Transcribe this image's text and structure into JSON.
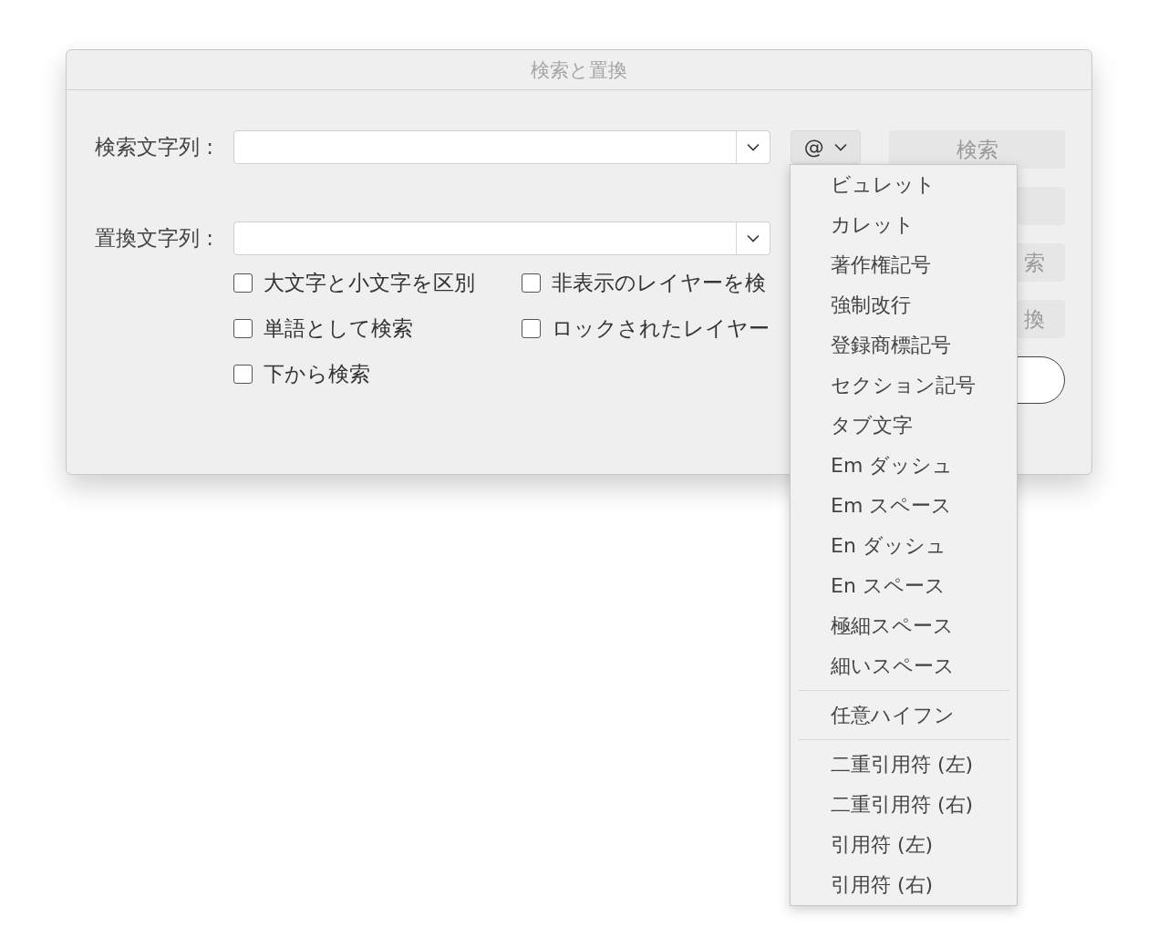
{
  "window": {
    "title": "検索と置換"
  },
  "fields": [
    {
      "label": "検索文字列 :"
    },
    {
      "label": "置換文字列 :"
    }
  ],
  "checkboxes": [
    {
      "label": "大文字と小文字を区別",
      "checked": false
    },
    {
      "label": "非表示のレイヤーを検",
      "checked": false
    },
    {
      "label": "単語として検索",
      "checked": false
    },
    {
      "label": "ロックされたレイヤー",
      "checked": false
    },
    {
      "label": "下から検索",
      "checked": false
    }
  ],
  "special_button": {
    "label": "@"
  },
  "buttons": [
    {
      "label": "検索",
      "kind": "filled",
      "disabled": true
    },
    {
      "kind": "filled"
    },
    {
      "label": "索",
      "kind": "filled",
      "disabled": true
    },
    {
      "label": "換",
      "kind": "filled",
      "disabled": true
    },
    {
      "kind": "outlined"
    }
  ],
  "menu": {
    "groups": [
      {
        "items": [
          "ビュレット",
          "カレット",
          "著作権記号",
          "強制改行",
          "登録商標記号",
          "セクション記号",
          "タブ文字",
          "Em ダッシュ",
          "Em スペース",
          "En ダッシュ",
          "En スペース",
          "極細スペース",
          "細いスペース"
        ]
      },
      {
        "items": [
          "任意ハイフン"
        ]
      },
      {
        "items": [
          "二重引用符 (左)",
          "二重引用符 (右)",
          "引用符 (左)",
          "引用符 (右)"
        ]
      }
    ]
  }
}
